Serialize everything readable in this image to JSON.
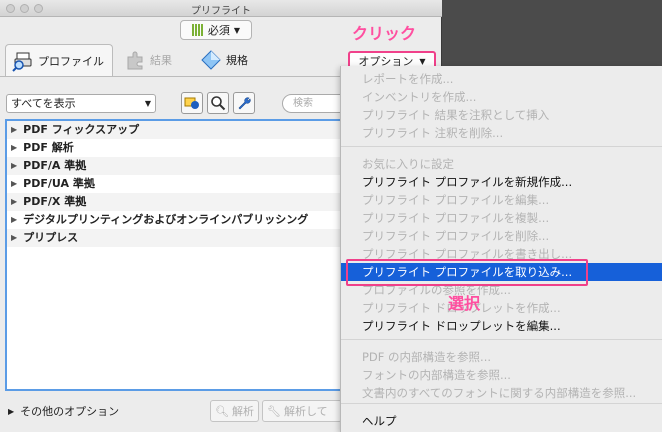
{
  "window": {
    "title": "プリフライト"
  },
  "toolbar": {
    "required_label": "必須"
  },
  "tabs": [
    {
      "label": "プロファイル"
    },
    {
      "label": "結果"
    },
    {
      "label": "規格"
    }
  ],
  "options_button": {
    "label": "オプション"
  },
  "annotations": {
    "click": "クリック",
    "select": "選択"
  },
  "filter": {
    "selected": "すべてを表示"
  },
  "search": {
    "placeholder": "検索"
  },
  "profile_list": [
    "PDF フィックスアップ",
    "PDF 解析",
    "PDF/A 準拠",
    "PDF/UA 準拠",
    "PDF/X 準拠",
    "デジタルプリンティングおよびオンラインパブリッシング",
    "プリプレス"
  ],
  "footer": {
    "more_options": "その他のオプション",
    "analyze_button": "解析",
    "analyze_fix_button": "解析して"
  },
  "menu": {
    "items": [
      {
        "label": "レポートを作成...",
        "enabled": false
      },
      {
        "label": "インベントリを作成...",
        "enabled": false
      },
      {
        "label": "プリフライト 結果を注釈として挿入",
        "enabled": false
      },
      {
        "label": "プリフライト 注釈を削除...",
        "enabled": false
      },
      {
        "label": "お気に入りに設定",
        "enabled": false
      },
      {
        "label": "プリフライト プロファイルを新規作成...",
        "enabled": true
      },
      {
        "label": "プリフライト プロファイルを編集...",
        "enabled": false
      },
      {
        "label": "プリフライト プロファイルを複製...",
        "enabled": false
      },
      {
        "label": "プリフライト プロファイルを削除...",
        "enabled": false
      },
      {
        "label": "プリフライト プロファイルを書き出し...",
        "enabled": false
      },
      {
        "label": "プリフライト プロファイルを取り込み...",
        "enabled": true,
        "highlighted": true
      },
      {
        "label": "プロファイルの参照を作成...",
        "enabled": false
      },
      {
        "label": "プリフライト ドロップレットを作成...",
        "enabled": false
      },
      {
        "label": "プリフライト ドロップレットを編集...",
        "enabled": true
      },
      {
        "label": "PDF の内部構造を参照...",
        "enabled": false
      },
      {
        "label": "フォントの内部構造を参照...",
        "enabled": false
      },
      {
        "label": "文書内のすべてのフォントに関する内部構造を参照...",
        "enabled": false
      },
      {
        "label": "ヘルプ",
        "enabled": true
      }
    ]
  },
  "colors": {
    "highlight": "#1660d9",
    "annotation": "#f0408a",
    "list_border": "#5b9ce6"
  }
}
